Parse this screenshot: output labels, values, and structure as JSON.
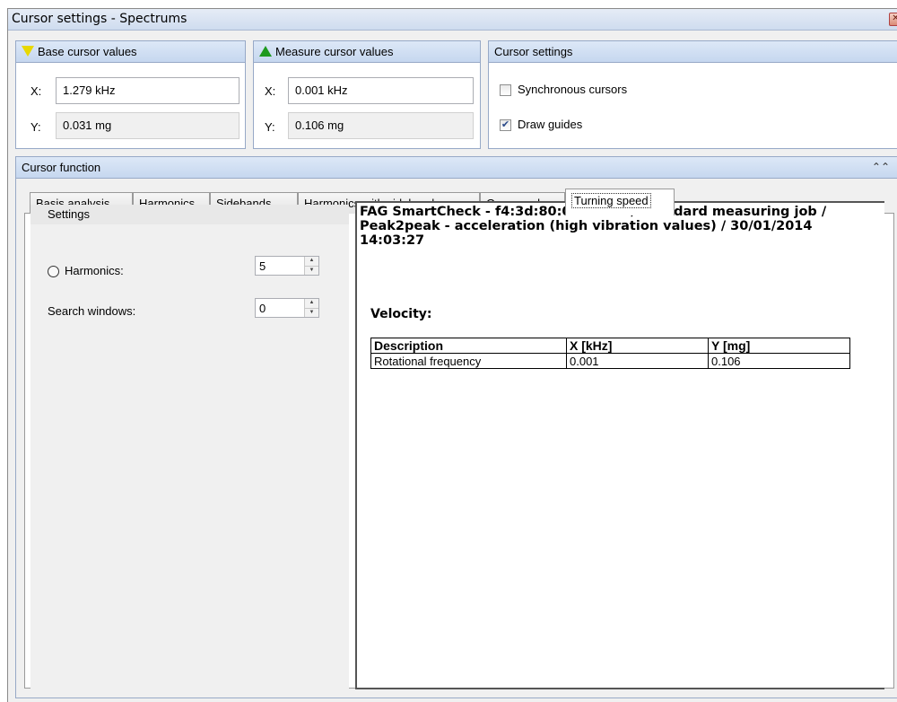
{
  "window": {
    "title": "Cursor settings - Spectrums"
  },
  "base_cursor": {
    "header": "Base cursor values",
    "x_label": "X:",
    "x_value": "1.279 kHz",
    "y_label": "Y:",
    "y_value": "0.031 mg"
  },
  "measure_cursor": {
    "header": "Measure cursor values",
    "x_label": "X:",
    "x_value": "0.001 kHz",
    "y_label": "Y:",
    "y_value": "0.106 mg"
  },
  "cursor_settings": {
    "header": "Cursor settings",
    "synchronous_label": "Synchronous cursors",
    "synchronous_checked": false,
    "draw_guides_label": "Draw guides",
    "draw_guides_checked": true
  },
  "cursor_function": {
    "header": "Cursor function",
    "tabs": [
      {
        "label": "Basis analysis"
      },
      {
        "label": "Harmonics"
      },
      {
        "label": "Sidebands"
      },
      {
        "label": "Harmonics with sidebands"
      },
      {
        "label": "Gear mesh"
      },
      {
        "label": "Turning speed"
      }
    ],
    "active_tab": "Turning speed"
  },
  "settings": {
    "header": "Settings",
    "harmonics_label": "Harmonics:",
    "harmonics_value": "5",
    "search_windows_label": "Search windows:",
    "search_windows_value": "0"
  },
  "report": {
    "title": "FAG SmartCheck - f4:3d:80:00:18:e6 / Standard measuring job / Peak2peak - acceleration (high vibration values) / 30/01/2014 14:03:27",
    "subtitle": "Velocity:",
    "columns": [
      "Description",
      "X [kHz]",
      "Y [mg]"
    ],
    "rows": [
      [
        "Rotational frequency",
        "0.001",
        "0.106"
      ]
    ]
  },
  "icons": {
    "base_cursor": "yellow-down-triangle-icon",
    "measure_cursor": "green-up-triangle-icon",
    "collapse": "double-chevron-up-icon",
    "close": "close-icon"
  },
  "colors": {
    "base_cursor_marker": "#e8d800",
    "measure_cursor_marker": "#1f9a1f",
    "group_header": "#c6d7ef"
  }
}
